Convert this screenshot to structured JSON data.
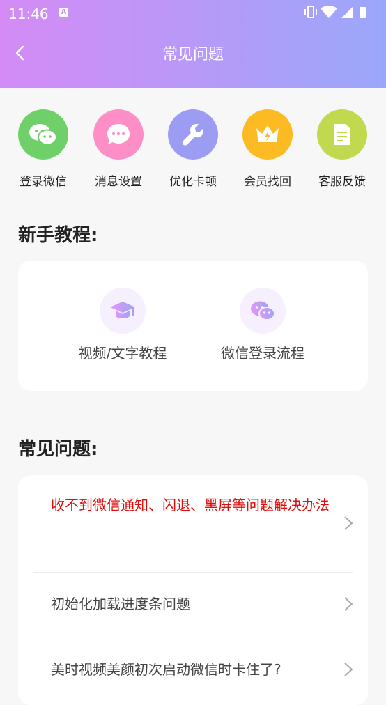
{
  "status_bar": {
    "time": "11:46",
    "notification_icon": "A"
  },
  "header": {
    "title": "常见问题"
  },
  "shortcuts": [
    {
      "label": "登录微信",
      "icon": "wechat-icon",
      "color": "#6fd06a"
    },
    {
      "label": "消息设置",
      "icon": "message-icon",
      "color": "#fd8ec6"
    },
    {
      "label": "优化卡顿",
      "icon": "wrench-icon",
      "color": "#9b9cf2"
    },
    {
      "label": "会员找回",
      "icon": "crown-icon",
      "color": "#fcbb23"
    },
    {
      "label": "客服反馈",
      "icon": "document-icon",
      "color": "#c0d94e"
    }
  ],
  "tutorial_section": {
    "title": "新手教程:",
    "items": [
      {
        "label": "视频/文字教程",
        "icon": "graduation-cap-icon"
      },
      {
        "label": "微信登录流程",
        "icon": "wechat-icon"
      }
    ]
  },
  "faq_section": {
    "title": "常见问题:",
    "items": [
      {
        "text": "收不到微信通知、闪退、黑屏等问题解决办法",
        "highlight": true
      },
      {
        "text": "初始化加载进度条问题",
        "highlight": false
      },
      {
        "text": "美时视频美颜初次启动微信时卡住了?",
        "highlight": false
      }
    ]
  }
}
